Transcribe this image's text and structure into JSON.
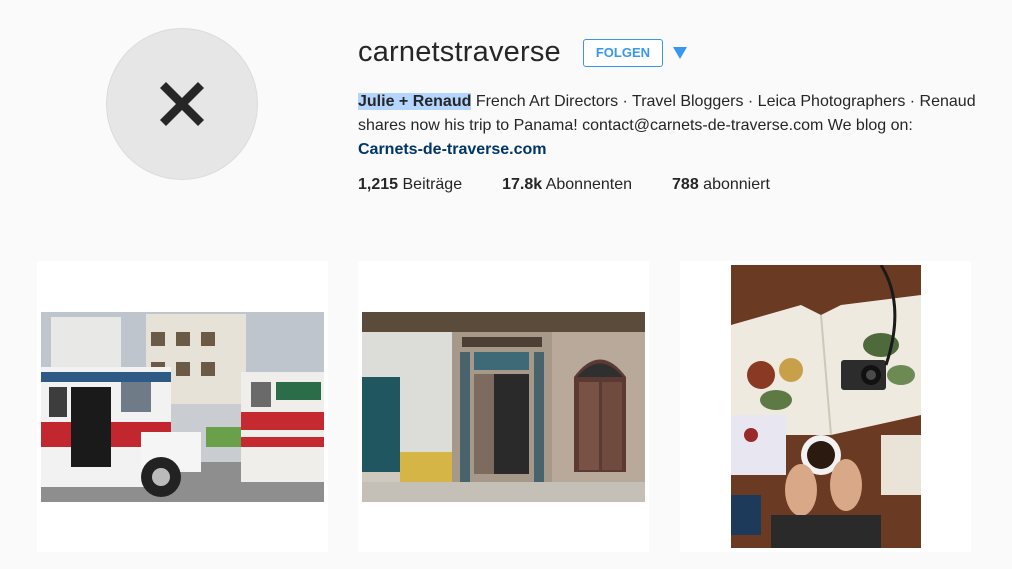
{
  "profile": {
    "username": "carnetstraverse",
    "follow_label": "FOLGEN",
    "bio": {
      "name": "Julie + Renaud",
      "text": " French Art Directors · Travel Bloggers · Leica Photographers · Renaud shares now his trip to Panama! contact@carnets-de-traverse.com We blog on: ",
      "link": "Carnets-de-traverse.com"
    },
    "stats": [
      {
        "count": "1,215",
        "label": "Beiträge"
      },
      {
        "count": "17.8k",
        "label": "Abonnenten"
      },
      {
        "count": "788",
        "label": "abonniert"
      }
    ]
  },
  "icons": {
    "avatar": "close-x-icon",
    "dropdown": "triangle-down-icon"
  },
  "colors": {
    "accent": "#3897f0",
    "link": "#003569",
    "highlight": "#b4d5fe",
    "background": "#fafafa"
  },
  "posts": [
    {
      "subject": "buses-street-photo"
    },
    {
      "subject": "old-doors-photo"
    },
    {
      "subject": "flatlay-book-camera-photo"
    }
  ]
}
